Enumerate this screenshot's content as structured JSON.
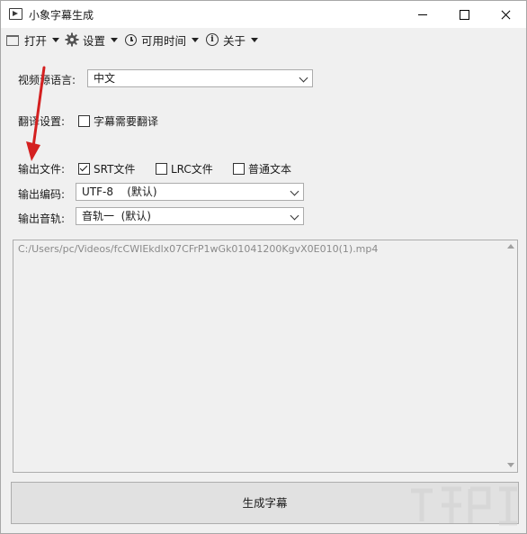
{
  "window": {
    "title": "小象字幕生成"
  },
  "menu": {
    "open": "打开",
    "settings": "设置",
    "available_time": "可用时间",
    "about": "关于"
  },
  "form": {
    "source_language_label": "视频源语言:",
    "source_language_value": "中文",
    "translate_label": "翻译设置:",
    "translate_checkbox": "字幕需要翻译",
    "output_file_label": "输出文件:",
    "output_srt": "SRT文件",
    "output_lrc": "LRC文件",
    "output_txt": "普通文本",
    "encoding_label": "输出编码:",
    "encoding_value": "UTF-8    (默认)",
    "audio_track_label": "输出音轨:",
    "audio_track_value": "音轨一  (默认)"
  },
  "file_list": [
    "C:/Users/pc/Videos/fcCWIEkdlx07CFrP1wGk01041200KgvX0E010(1).mp4"
  ],
  "generate_button": "生成字幕",
  "colors": {
    "arrow": "#d42020",
    "window_bg": "#f0f0f0"
  }
}
